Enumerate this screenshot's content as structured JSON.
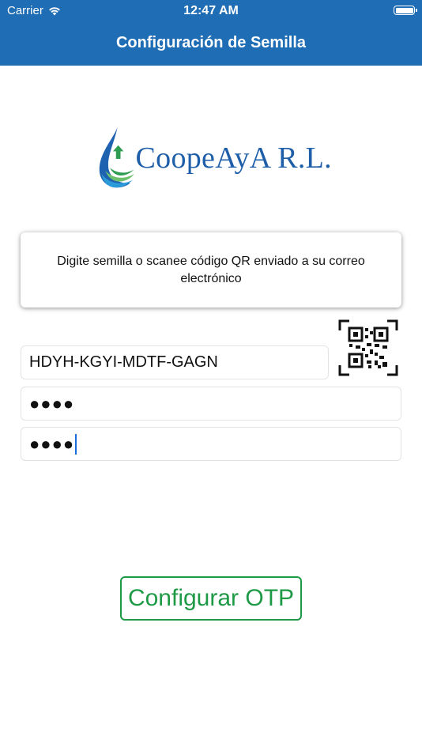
{
  "status_bar": {
    "carrier": "Carrier",
    "time": "12:47 AM"
  },
  "nav": {
    "title": "Configuración de Semilla"
  },
  "logo": {
    "text": "CoopeAyA R.L."
  },
  "message": {
    "text": "Digite semilla o scanee código QR enviado a su correo electrónico"
  },
  "form": {
    "seed_value": "HDYH-KGYI-MDTF-GAGN",
    "password1_masked": "●●●●",
    "password2_masked": "●●●●"
  },
  "actions": {
    "configure_label": "Configurar OTP"
  },
  "colors": {
    "header_bg": "#1f6db5",
    "accent_green": "#1e9a46",
    "logo_blue": "#1f5ea8"
  },
  "icons": [
    "wifi-icon",
    "battery-icon",
    "qr-code-icon",
    "water-drop-logo-icon"
  ]
}
